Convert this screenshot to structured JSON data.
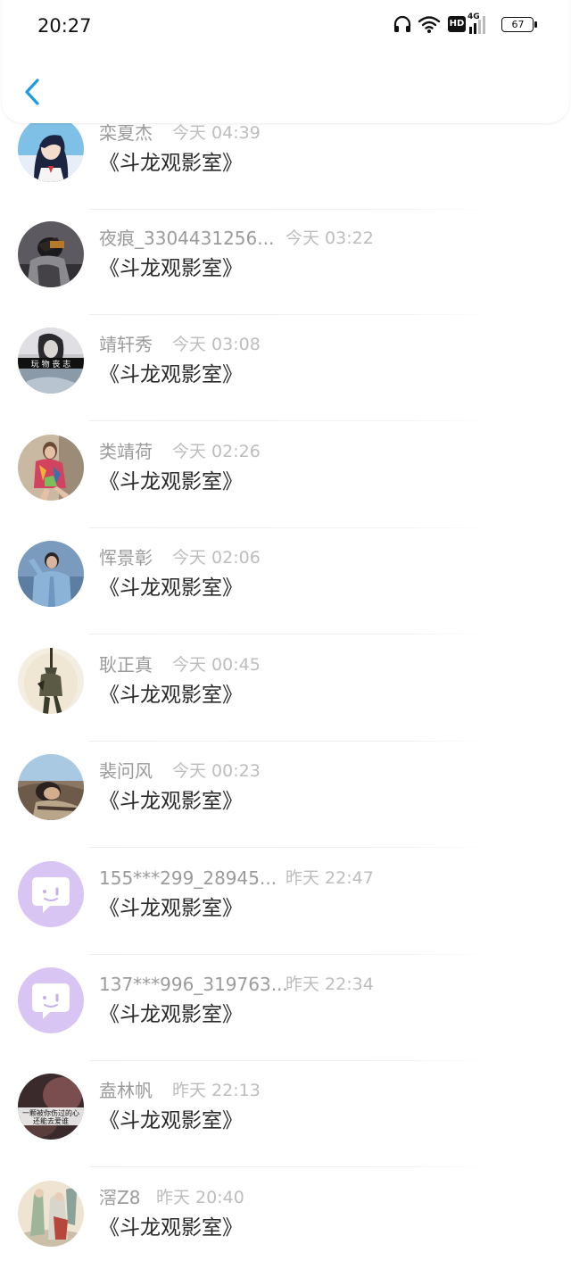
{
  "status_bar": {
    "time": "20:27",
    "hd_label": "HD",
    "network_label": "4G",
    "battery": "67",
    "icons": [
      "headphones-icon",
      "wifi-icon",
      "hd-icon",
      "signal-4g-icon",
      "battery-icon"
    ]
  },
  "header": {
    "back_icon": "chevron-left-icon",
    "accent_color": "#1e9be0"
  },
  "messages": [
    {
      "name": "栾夏杰",
      "time": "今天 04:39",
      "text": "《斗龙观影室》",
      "avatar": "anime-girl"
    },
    {
      "name": "夜痕_3304431256...",
      "time": "今天 03:22",
      "text": "《斗龙观影室》",
      "avatar": "dark-figure"
    },
    {
      "name": "靖轩秀",
      "time": "今天 03:08",
      "text": "《斗龙观影室》",
      "avatar": "bw-girl",
      "avatar_caption": "玩 物 丧 志"
    },
    {
      "name": "类靖荷",
      "time": "今天 02:26",
      "text": "《斗龙观影室》",
      "avatar": "colorful-woman"
    },
    {
      "name": "恽景彰",
      "time": "今天 02:06",
      "text": "《斗龙观影室》",
      "avatar": "blue-man"
    },
    {
      "name": "耿正真",
      "time": "今天 00:45",
      "text": "《斗龙观影室》",
      "avatar": "soldier"
    },
    {
      "name": "裴问风",
      "time": "今天 00:23",
      "text": "《斗龙观影室》",
      "avatar": "lying-person"
    },
    {
      "name": "155***299_28945...",
      "time": "昨天 22:47",
      "text": "《斗龙观影室》",
      "avatar": "default-chat"
    },
    {
      "name": "137***996_319763...",
      "time": "昨天 22:34",
      "text": "《斗龙观影室》",
      "avatar": "default-chat"
    },
    {
      "name": "盍林帆",
      "time": "昨天 22:13",
      "text": "《斗龙观影室》",
      "avatar": "dark-text",
      "avatar_caption_1": "一颗被你伤过的心",
      "avatar_caption_2": "还能去爱谁"
    },
    {
      "name": "滘Z8",
      "time": "昨天 20:40",
      "text": "《斗龙观影室》",
      "avatar": "painting"
    }
  ],
  "colors": {
    "name_text": "#9b9b9b",
    "time_text": "#bdbdbd",
    "message_text": "#2a2a2a",
    "default_avatar": "#d9c5f3"
  }
}
